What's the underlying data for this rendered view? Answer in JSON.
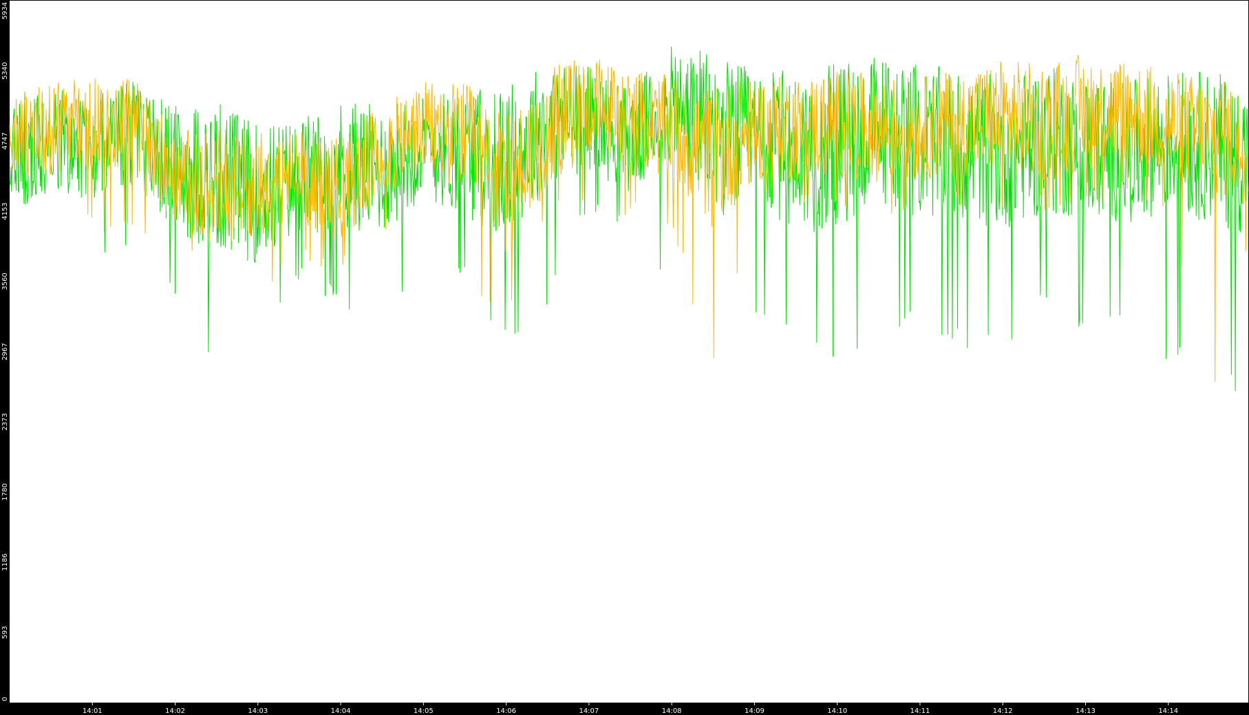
{
  "chart_data": {
    "type": "line",
    "title": "",
    "xlabel": "",
    "ylabel": "",
    "background": "#ffffff",
    "frame_color": "#000000",
    "grid": false,
    "legend": "none",
    "ylim": [
      0,
      5934
    ],
    "yticks": [
      "0",
      "593",
      "1186",
      "1780",
      "2373",
      "2967",
      "3560",
      "4153",
      "4747",
      "5340",
      "5934"
    ],
    "xrange": [
      "14:00:00",
      "14:14:58"
    ],
    "xticks": [
      "14:01",
      "14:02",
      "14:03",
      "14:04",
      "14:05",
      "14:06",
      "14:07",
      "14:08",
      "14:09",
      "14:10",
      "14:11",
      "14:12",
      "14:13",
      "14:14"
    ],
    "x_anchor_times": [
      "14:00:00",
      "14:00:30",
      "14:01:00",
      "14:01:30",
      "14:02:00",
      "14:02:30",
      "14:03:00",
      "14:03:30",
      "14:04:00",
      "14:04:30",
      "14:05:00",
      "14:05:30",
      "14:06:00",
      "14:06:30",
      "14:07:00",
      "14:07:30",
      "14:08:00",
      "14:08:30",
      "14:09:00",
      "14:09:30",
      "14:10:00",
      "14:10:30",
      "14:11:00",
      "14:11:30",
      "14:12:00",
      "14:12:30",
      "14:13:00",
      "14:13:30",
      "14:14:00",
      "14:14:30",
      "14:14:58"
    ],
    "series": [
      {
        "color": "#00e000",
        "level": [
          4600,
          4750,
          4700,
          4800,
          4500,
          4450,
          4300,
          4450,
          4550,
          4500,
          4700,
          4650,
          4550,
          4900,
          4950,
          4750,
          5050,
          4800,
          4750,
          4650,
          4700,
          4850,
          4750,
          4700,
          4650,
          4750,
          4700,
          4650,
          4750,
          4700,
          4600
        ],
        "spread": [
          450,
          450,
          450,
          450,
          550,
          650,
          600,
          500,
          550,
          550,
          450,
          550,
          650,
          550,
          450,
          450,
          500,
          700,
          600,
          700,
          700,
          650,
          650,
          650,
          650,
          650,
          600,
          600,
          600,
          650,
          650
        ],
        "min_dips": [
          3900,
          3800,
          3650,
          3800,
          3450,
          2700,
          3150,
          3550,
          3350,
          3000,
          3800,
          3600,
          3000,
          3350,
          4150,
          3900,
          3450,
          3050,
          3300,
          3100,
          2750,
          3200,
          3150,
          3000,
          2950,
          3350,
          3050,
          3250,
          2850,
          2950,
          2400
        ]
      },
      {
        "color": "#ffb800",
        "level": [
          4800,
          4850,
          4900,
          4900,
          4450,
          4350,
          4400,
          4450,
          4350,
          4650,
          4850,
          4800,
          4350,
          4850,
          5050,
          4950,
          4850,
          4600,
          4850,
          4850,
          4900,
          4850,
          4850,
          4900,
          4950,
          4900,
          5000,
          5000,
          4900,
          4800,
          4700
        ],
        "spread": [
          350,
          400,
          400,
          400,
          400,
          500,
          450,
          400,
          450,
          400,
          400,
          450,
          600,
          500,
          450,
          400,
          450,
          600,
          450,
          450,
          450,
          450,
          450,
          450,
          500,
          500,
          500,
          450,
          450,
          500,
          500
        ],
        "min_dips": [
          4100,
          4150,
          4000,
          3900,
          3800,
          3650,
          3450,
          3700,
          3600,
          3900,
          4050,
          3550,
          3250,
          4050,
          4250,
          4100,
          4000,
          2750,
          4200,
          4150,
          4150,
          4100,
          4100,
          4150,
          4150,
          4150,
          4200,
          4200,
          4100,
          2500,
          3900
        ]
      }
    ]
  }
}
